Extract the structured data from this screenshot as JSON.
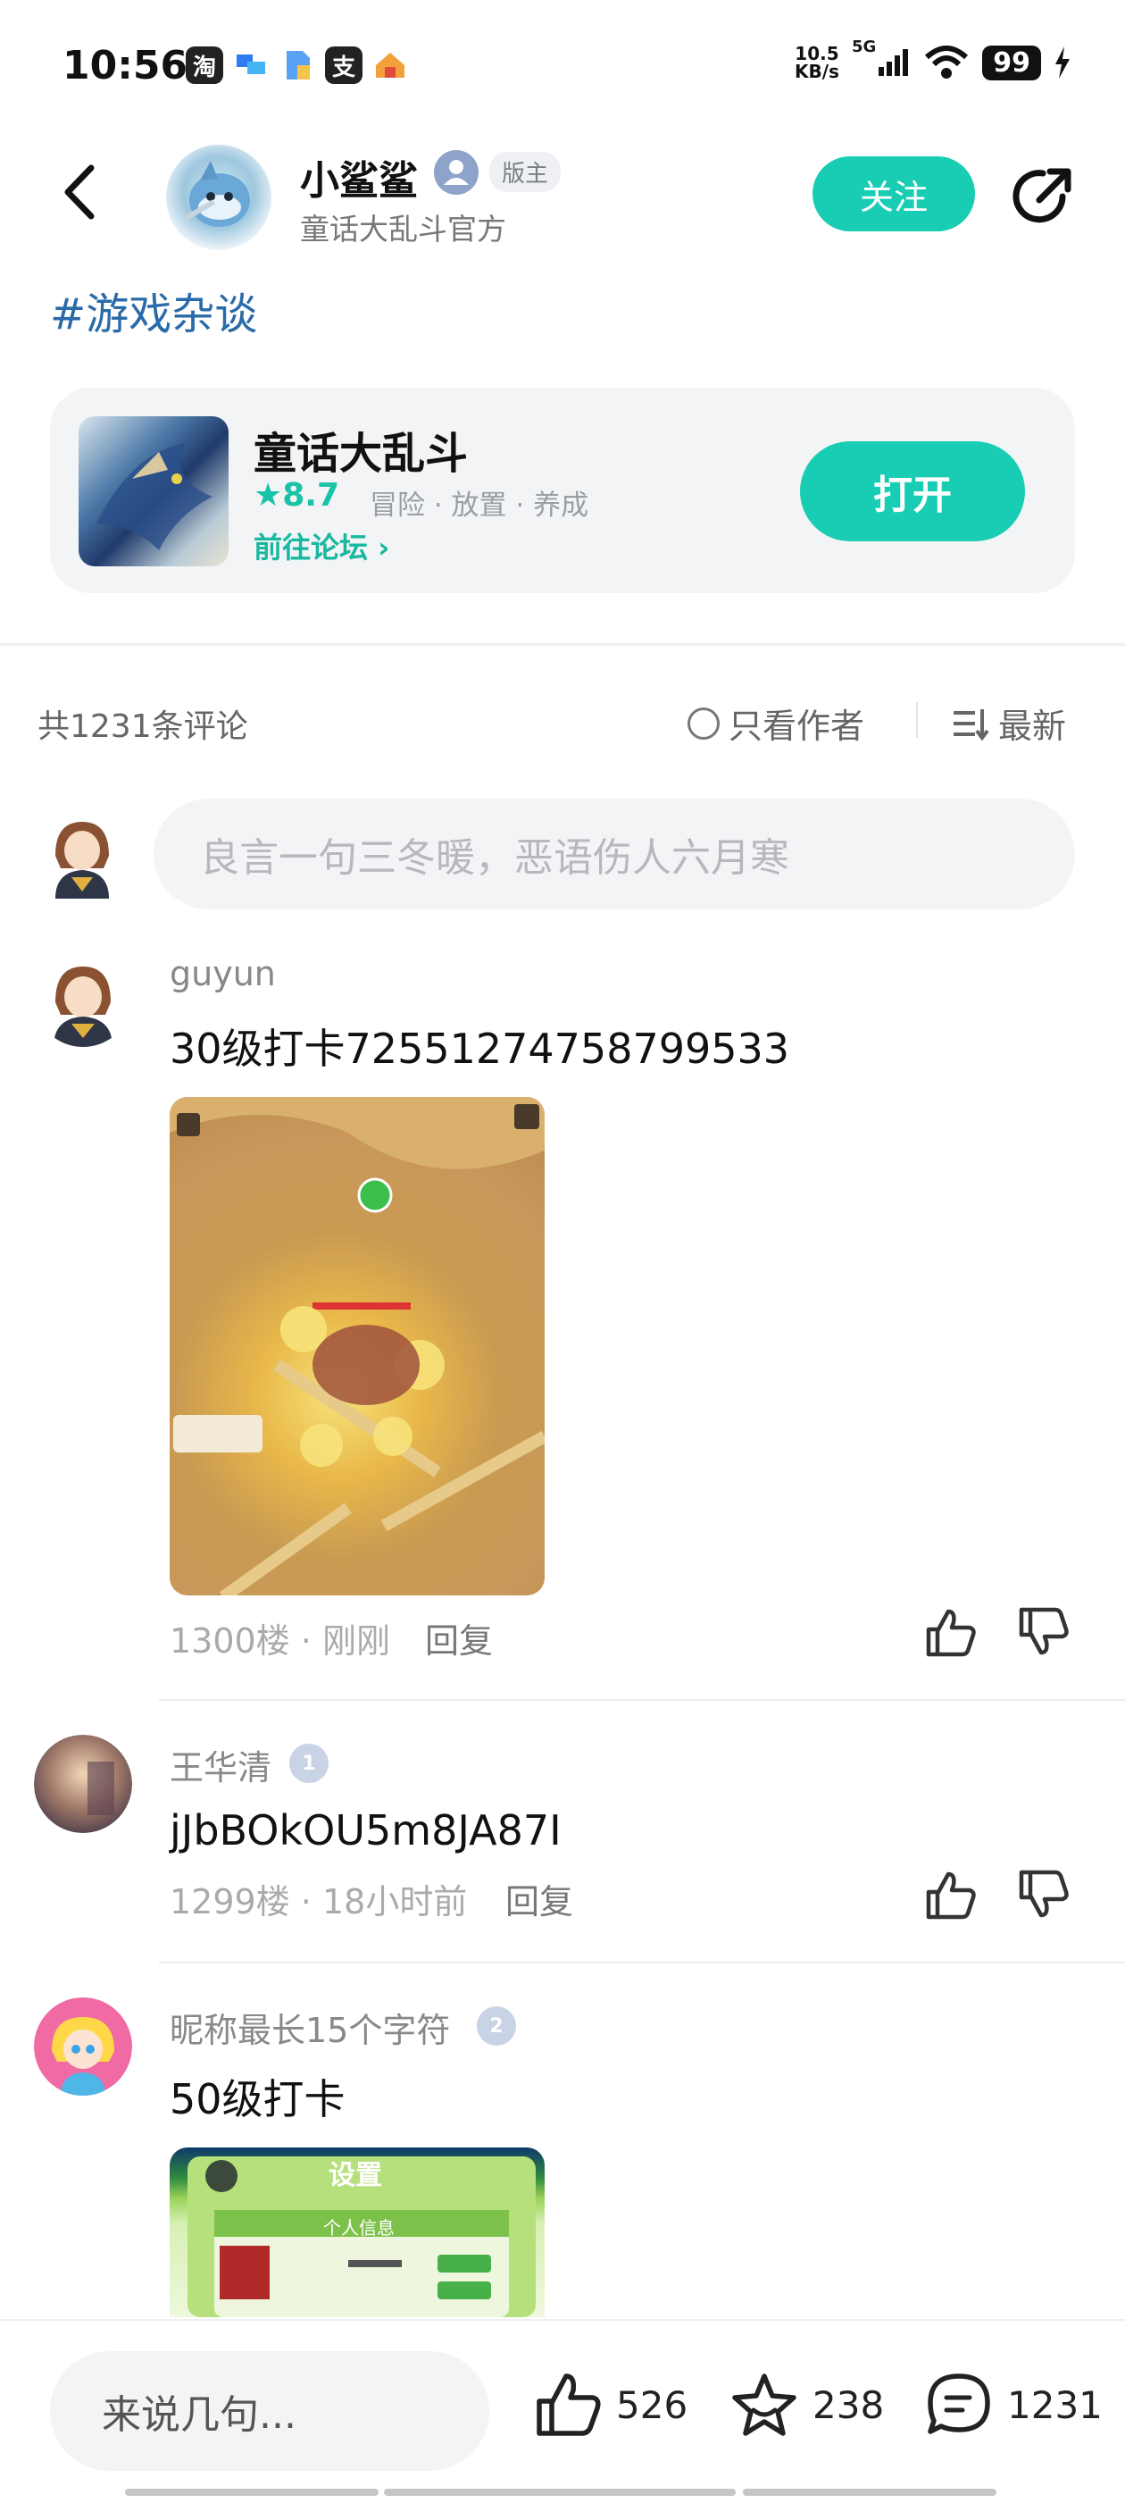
{
  "status_bar": {
    "time": "10:56",
    "apps": [
      {
        "name": "taobao-icon",
        "glyph": "淘",
        "color": "#222222"
      },
      {
        "name": "chat-app-icon",
        "glyph": "",
        "color": "#2f7bf2"
      },
      {
        "name": "notes-app-icon",
        "glyph": "",
        "color": "#5aa2f5"
      },
      {
        "name": "alipay-icon",
        "glyph": "支",
        "color": "#222222"
      },
      {
        "name": "home-app-icon",
        "glyph": "",
        "color": "#f2a13a"
      }
    ],
    "net_speed_value": "10.5",
    "net_speed_unit": "KB/s",
    "network": "5G",
    "battery": "99"
  },
  "header": {
    "author_name": "小鲨鲨",
    "mod_badge": "版主",
    "author_subtitle": "童话大乱斗官方",
    "follow_label": "关注"
  },
  "topic": {
    "tag": "#游戏杂谈"
  },
  "game_card": {
    "title": "童话大乱斗",
    "rating": "★8.7",
    "tags": "冒险 · 放置 · 养成",
    "forum_link": "前往论坛 ›",
    "open_label": "打开"
  },
  "comments_header": {
    "count": "共1231条评论",
    "author_only": "只看作者",
    "sort_label": "最新"
  },
  "comment_input": {
    "placeholder": "良言一句三冬暖，恶语伤人六月寒"
  },
  "comments": [
    {
      "user": "guyun",
      "text": "30级打卡72551274758799533",
      "floor": "1300楼",
      "time": "刚刚",
      "reply_label": "回复"
    },
    {
      "user": "王华清",
      "level": "1",
      "text": "jJbBOkOU5m8JA87I",
      "floor": "1299楼",
      "time": "18小时前",
      "reply_label": "回复"
    },
    {
      "user": "昵称最长15个字符",
      "level": "2",
      "text": "50级打卡"
    }
  ],
  "screenshot_texts": {
    "settings_title": "设置",
    "personal_info": "个人信息"
  },
  "bottom_bar": {
    "input_placeholder": "来说几句...",
    "likes": "526",
    "favorites": "238",
    "comments": "1231"
  },
  "colors": {
    "accent": "#19cdb4",
    "topic": "#2a6aa8"
  }
}
